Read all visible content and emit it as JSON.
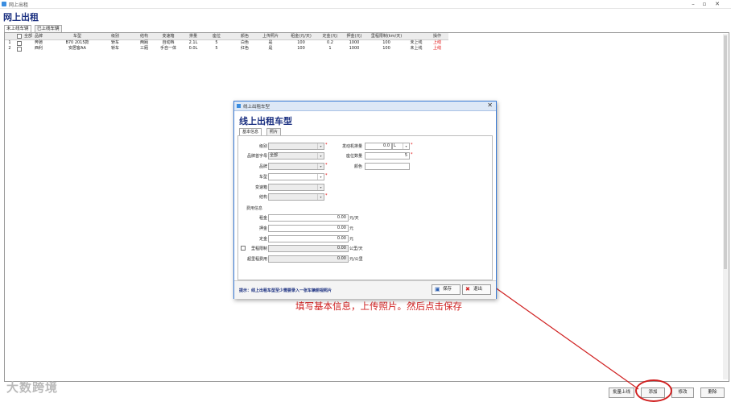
{
  "window": {
    "title": "网上出租"
  },
  "page_title": "网上出租",
  "tabs": [
    {
      "label": "未上线车辆"
    },
    {
      "label": "已上线车辆"
    }
  ],
  "grid": {
    "select_all": "全部",
    "headers": [
      "品牌",
      "车型",
      "级别",
      "结构",
      "变速箱",
      "排量",
      "座位",
      "颜色",
      "上传照片",
      "租金(元/天)",
      "定金(元)",
      "押金(元)",
      "里程限制(km/天)",
      "",
      "操作"
    ],
    "rows": [
      {
        "no": "1",
        "cells": [
          "奔驰",
          "B70 2015款",
          "轿车",
          "两厢",
          "自动档",
          "2.1L",
          "5",
          "白色",
          "是",
          "100",
          "0.2",
          "1000",
          "100",
          "未上线",
          "上线"
        ]
      },
      {
        "no": "2",
        "cells": [
          "西利",
          "安居客AA",
          "轿车",
          "三厢",
          "手自一体",
          "0.0L",
          "5",
          "红色",
          "是",
          "100",
          "1",
          "1000",
          "100",
          "未上线",
          "上线"
        ]
      }
    ]
  },
  "bottom_buttons": {
    "batch_online": "批量上线",
    "add": "添加",
    "edit": "修改",
    "delete": "删除"
  },
  "watermark": "大数跨境",
  "annotation": "填写基本信息，上传照片。然后点击保存",
  "dialog": {
    "title": "线上出租车型",
    "heading": "线上出租车型",
    "tabs": [
      {
        "label": "基本信息"
      },
      {
        "label": "照片"
      }
    ],
    "fields": {
      "level": {
        "label": "级别",
        "value": ""
      },
      "brand_initial": {
        "label": "品牌首字母",
        "value": "全部"
      },
      "brand": {
        "label": "品牌",
        "value": ""
      },
      "model": {
        "label": "车型",
        "value": ""
      },
      "gearbox": {
        "label": "变速箱",
        "value": ""
      },
      "structure": {
        "label": "结构",
        "value": ""
      },
      "engine": {
        "label": "发动机排量",
        "value": "0.0",
        "unit": "L"
      },
      "seats": {
        "label": "座位数量",
        "value": "5"
      },
      "color": {
        "label": "颜色",
        "value": ""
      }
    },
    "fee_section": "费用信息",
    "fees": {
      "rent": {
        "label": "租金",
        "value": "0.00",
        "unit": "元/天"
      },
      "deposit": {
        "label": "押金",
        "value": "0.00",
        "unit": "元"
      },
      "down_payment": {
        "label": "定金",
        "value": "0.00",
        "unit": "元"
      },
      "mileage": {
        "label": "里程限制",
        "value": "0.00",
        "unit": "公里/天"
      },
      "overage": {
        "label": "超里程费用",
        "value": "0.00",
        "unit": "元/公里"
      }
    },
    "required_mark": "*",
    "hint": "提示：线上出租车型至少需要录入一张车辆俯视照片",
    "buttons": {
      "save": "保存",
      "exit": "退出"
    }
  },
  "colors": {
    "title_blue": "#1a2f80",
    "accent_red": "#d02020",
    "link_red": "#e00000"
  }
}
